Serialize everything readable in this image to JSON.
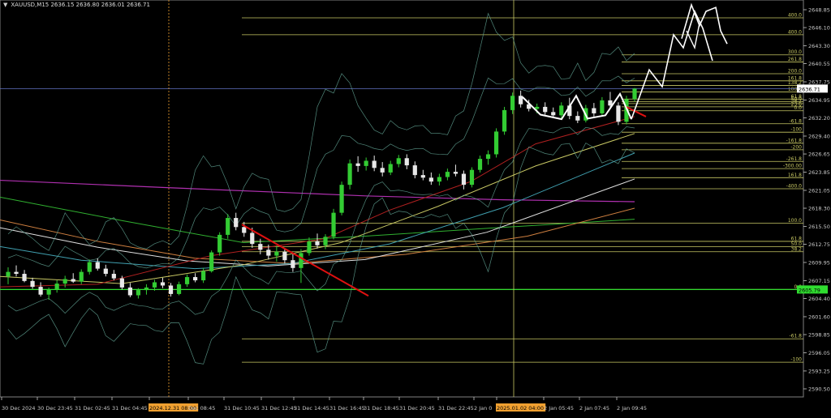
{
  "symbol_bar": {
    "dropdown_icon": "triangle-down-icon",
    "text": "XAUUSD,M15  2636.15 2636.80 2636.01 2636.71"
  },
  "colors": {
    "background": "#000000",
    "axis": "#c8c8c8",
    "bull_candle": "#33cc33",
    "bear_candle": "#e8e8e8",
    "fib_line": "#c8c864",
    "ma_purple": "#b030b0",
    "ma_white": "#e0e0e0",
    "ma_orange": "#d08040",
    "ma_teal": "#40a0b0",
    "ma_green": "#30b030",
    "ma_yellow": "#c8c864",
    "bollinger": "#5fa090",
    "trendline_red": "#e01010",
    "projection": "#ffffff",
    "current_price_line": "#6070c0",
    "green_level": "#30dd30",
    "date_highlight": "#f0a030"
  },
  "chart_data": {
    "type": "candlestick",
    "symbol": "XAUUSD",
    "timeframe": "M15",
    "ohlc_header": {
      "open": 2636.15,
      "high": 2636.8,
      "low": 2636.01,
      "close": 2636.71
    },
    "ylim": [
      2590.0,
      2650.0
    ],
    "y_ticks": [
      2648.85,
      2646.1,
      2643.3,
      2640.55,
      2637.75,
      2634.95,
      2632.2,
      2629.4,
      2626.65,
      2623.85,
      2621.05,
      2618.3,
      2615.5,
      2612.75,
      2609.95,
      2607.15,
      2604.4,
      2601.6,
      2598.85,
      2596.05,
      2593.25,
      2590.5
    ],
    "y_tick_labels": [
      "2648.85",
      "2646.10",
      "2643.30",
      "2640.55",
      "2637.75",
      "2634.95",
      "2632.20",
      "2629.40",
      "2626.65",
      "2623.85",
      "2621.05",
      "2618.30",
      "2615.50",
      "2612.75",
      "2609.95",
      "2607.15",
      "2604.40",
      "2601.60",
      "2598.85",
      "2596.05",
      "2593.25",
      "2590.50"
    ],
    "x_labels": [
      "30 Dec 2024",
      "30 Dec 23:45",
      "31 Dec 02:45",
      "31 Dec 04:45",
      "2024.12.31 08:00",
      "Dec 08:45",
      "31 Dec 10:45",
      "31 Dec 12:45",
      "31 Dec 14:45",
      "31 Dec 16:45",
      "31 Dec 18:45",
      "31 Dec 20:45",
      "31 Dec 22:45",
      "2 Jan 0",
      "2025.01.02 04:00",
      "2 Jan 05:45",
      "2 Jan 07:45",
      "2 Jan 09:45"
    ],
    "highlighted_x_labels": [
      "2024.12.31 08:00",
      "2025.01.02 04:00"
    ],
    "current_price": {
      "value": 2636.71,
      "label": "2636.71"
    },
    "green_level": {
      "value": 2605.79,
      "label": "2605.79"
    },
    "fib_levels_right": [
      {
        "label": "400.0",
        "value": 2647.6
      },
      {
        "label": "400.0",
        "value": 2645.0
      },
      {
        "label": "300.0",
        "value": 2641.9
      },
      {
        "label": "261.8",
        "value": 2640.8
      },
      {
        "label": "200.0",
        "value": 2639.0
      },
      {
        "label": "161.8",
        "value": 2637.9
      },
      {
        "label": "138.2",
        "value": 2637.2
      },
      {
        "label": "100.0",
        "value": 2636.2
      },
      {
        "label": "61.8",
        "value": 2635.1
      },
      {
        "label": "50.0",
        "value": 2634.7
      },
      {
        "label": "38.2",
        "value": 2634.4
      },
      {
        "label": "23.6",
        "value": 2633.9
      },
      {
        "label": "0.0",
        "value": 2633.3
      },
      {
        "label": "-61.8",
        "value": 2631.3
      },
      {
        "label": "-100",
        "value": 2630.0
      },
      {
        "label": "-161.8",
        "value": 2628.3
      },
      {
        "label": "-200",
        "value": 2627.3
      },
      {
        "label": "-261.8",
        "value": 2625.5
      },
      {
        "label": "-300.00",
        "value": 2624.4
      },
      {
        "label": "161.8",
        "value": 2623.0
      },
      {
        "label": "-400.0",
        "value": 2621.3
      },
      {
        "label": "100.0",
        "value": 2616.0
      },
      {
        "label": "61.8",
        "value": 2613.2
      },
      {
        "label": "50.0",
        "value": 2612.4
      },
      {
        "label": "38.2",
        "value": 2611.6
      },
      {
        "label": "0.0",
        "value": 2605.8
      },
      {
        "label": "-61.8",
        "value": 2598.2
      },
      {
        "label": "-100",
        "value": 2594.6
      }
    ],
    "candles": [
      [
        2607.8,
        2609.2,
        2606.6,
        2608.5
      ],
      [
        2608.5,
        2609.5,
        2607.8,
        2608.2
      ],
      [
        2608.2,
        2608.8,
        2606.9,
        2607.1
      ],
      [
        2607.1,
        2607.6,
        2605.9,
        2606.2
      ],
      [
        2606.2,
        2606.9,
        2604.7,
        2605.0
      ],
      [
        2605.0,
        2606.1,
        2604.2,
        2605.8
      ],
      [
        2605.8,
        2607.2,
        2605.3,
        2606.7
      ],
      [
        2606.7,
        2607.9,
        2606.1,
        2607.4
      ],
      [
        2607.4,
        2608.3,
        2606.8,
        2607.0
      ],
      [
        2607.0,
        2608.9,
        2606.6,
        2608.5
      ],
      [
        2608.5,
        2610.4,
        2608.1,
        2610.0
      ],
      [
        2610.0,
        2610.6,
        2608.7,
        2609.0
      ],
      [
        2609.0,
        2609.6,
        2607.8,
        2608.2
      ],
      [
        2608.2,
        2608.8,
        2607.2,
        2607.5
      ],
      [
        2607.5,
        2607.9,
        2605.8,
        2606.1
      ],
      [
        2606.1,
        2606.8,
        2604.6,
        2604.9
      ],
      [
        2604.9,
        2606.0,
        2604.4,
        2605.7
      ],
      [
        2605.7,
        2606.6,
        2605.0,
        2606.1
      ],
      [
        2606.1,
        2607.3,
        2605.6,
        2606.9
      ],
      [
        2606.9,
        2607.6,
        2606.0,
        2606.4
      ],
      [
        2606.4,
        2606.8,
        2604.7,
        2605.1
      ],
      [
        2605.1,
        2607.0,
        2604.9,
        2606.6
      ],
      [
        2606.6,
        2608.1,
        2606.2,
        2607.7
      ],
      [
        2607.7,
        2608.3,
        2606.9,
        2607.2
      ],
      [
        2607.2,
        2609.1,
        2606.8,
        2608.6
      ],
      [
        2608.6,
        2611.8,
        2608.4,
        2611.5
      ],
      [
        2611.5,
        2614.6,
        2611.0,
        2614.2
      ],
      [
        2614.2,
        2617.4,
        2613.6,
        2616.8
      ],
      [
        2616.8,
        2617.6,
        2614.9,
        2615.4
      ],
      [
        2615.4,
        2616.2,
        2613.9,
        2614.5
      ],
      [
        2614.5,
        2615.3,
        2612.2,
        2612.8
      ],
      [
        2612.8,
        2613.6,
        2611.2,
        2611.9
      ],
      [
        2611.9,
        2612.7,
        2610.4,
        2611.0
      ],
      [
        2611.0,
        2612.5,
        2610.1,
        2611.6
      ],
      [
        2611.6,
        2612.1,
        2609.8,
        2610.3
      ],
      [
        2610.3,
        2611.4,
        2608.5,
        2609.1
      ],
      [
        2609.1,
        2612.0,
        2606.8,
        2611.4
      ],
      [
        2611.4,
        2613.8,
        2611.0,
        2613.2
      ],
      [
        2613.2,
        2614.4,
        2612.1,
        2612.6
      ],
      [
        2612.6,
        2614.3,
        2612.0,
        2613.9
      ],
      [
        2613.9,
        2618.2,
        2613.5,
        2617.6
      ],
      [
        2617.6,
        2622.4,
        2617.2,
        2621.9
      ],
      [
        2621.9,
        2625.8,
        2621.2,
        2625.2
      ],
      [
        2625.2,
        2626.3,
        2623.9,
        2624.8
      ],
      [
        2624.8,
        2626.1,
        2624.1,
        2625.6
      ],
      [
        2625.6,
        2626.4,
        2624.0,
        2624.5
      ],
      [
        2624.5,
        2625.4,
        2623.2,
        2623.8
      ],
      [
        2623.8,
        2625.6,
        2623.4,
        2625.1
      ],
      [
        2625.1,
        2626.5,
        2624.6,
        2626.0
      ],
      [
        2626.0,
        2626.6,
        2624.3,
        2624.9
      ],
      [
        2624.9,
        2625.5,
        2622.9,
        2623.4
      ],
      [
        2623.4,
        2624.2,
        2622.6,
        2623.0
      ],
      [
        2623.0,
        2623.8,
        2621.9,
        2622.4
      ],
      [
        2622.4,
        2623.6,
        2621.8,
        2623.1
      ],
      [
        2623.1,
        2624.4,
        2622.6,
        2623.9
      ],
      [
        2623.9,
        2625.0,
        2623.2,
        2623.6
      ],
      [
        2623.6,
        2624.1,
        2621.2,
        2621.9
      ],
      [
        2621.9,
        2624.6,
        2621.5,
        2624.2
      ],
      [
        2624.2,
        2626.4,
        2623.8,
        2625.9
      ],
      [
        2625.9,
        2627.2,
        2625.0,
        2626.6
      ],
      [
        2626.6,
        2630.6,
        2626.1,
        2630.1
      ],
      [
        2630.1,
        2633.9,
        2629.6,
        2633.4
      ],
      [
        2633.4,
        2636.1,
        2632.8,
        2635.6
      ],
      [
        2635.6,
        2636.4,
        2633.8,
        2634.3
      ],
      [
        2634.3,
        2635.0,
        2633.2,
        2633.6
      ],
      [
        2633.6,
        2634.4,
        2632.9,
        2633.9
      ],
      [
        2633.9,
        2634.6,
        2632.7,
        2633.1
      ],
      [
        2633.1,
        2633.8,
        2632.2,
        2632.6
      ],
      [
        2632.6,
        2634.6,
        2632.1,
        2634.1
      ],
      [
        2634.1,
        2635.3,
        2632.0,
        2632.5
      ],
      [
        2632.5,
        2633.2,
        2631.4,
        2631.8
      ],
      [
        2631.8,
        2634.2,
        2631.5,
        2633.7
      ],
      [
        2633.7,
        2634.5,
        2632.4,
        2632.9
      ],
      [
        2632.9,
        2635.4,
        2632.5,
        2634.9
      ],
      [
        2634.9,
        2636.2,
        2633.6,
        2634.1
      ],
      [
        2634.1,
        2634.6,
        2631.1,
        2631.6
      ],
      [
        2631.6,
        2635.6,
        2631.2,
        2635.1
      ],
      [
        2635.1,
        2636.8,
        2634.7,
        2636.7
      ]
    ],
    "annotations": [
      {
        "type": "red_trendline",
        "from": [
          2615.8
        ],
        "to": [
          2604.8
        ]
      },
      {
        "type": "white_projection",
        "description": "zigzag projection"
      }
    ]
  }
}
